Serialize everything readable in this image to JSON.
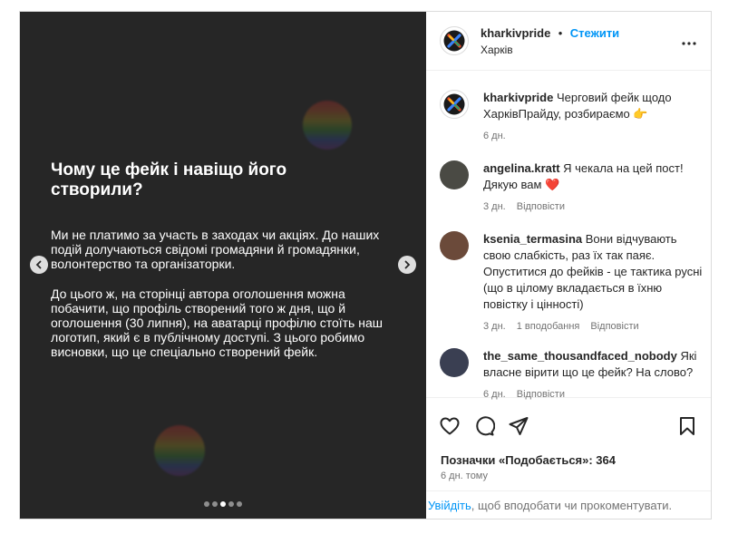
{
  "slide": {
    "title": "Чому це фейк і навіщо його створили?",
    "paragraph1": "Ми не платимо за участь в заходах чи акціях. До наших подій долучаються свідомі громадяни й громадянки, волонтерство та організаторки.",
    "paragraph2": "До цього ж, на сторінці автора оголошення можна побачити, що профіль створений того ж дня, що й оголошення (30 липня), на аватарці профілю стоїть наш логотип, який є в публічному доступі. З цього робимо висновки, що це спеціально створений фейк.",
    "dots_count": 5,
    "active_dot": 2
  },
  "header": {
    "username": "kharkivpride",
    "separator": "•",
    "follow_label": "Стежити",
    "location": "Харків",
    "more_icon": "more-horizontal-icon"
  },
  "caption": {
    "username": "kharkivpride",
    "text": "Черговий фейк щодо ХарківПрайду, розбираємо 👉",
    "time": "6 дн."
  },
  "comments": [
    {
      "username": "angelina.kratt",
      "text": "Я чекала на цей пост! Дякую вам ❤️",
      "time": "3 дн.",
      "likes": "",
      "reply": "Відповісти",
      "avatar_color": "#4a4a44"
    },
    {
      "username": "ksenia_termasina",
      "text": "Вони відчувають свою слабкість, раз їх так паяє. Опуститися до фейків - це тактика русні (що в цілому вкладається в їхню повістку і цінності)",
      "time": "3 дн.",
      "likes": "1 вподобання",
      "reply": "Відповісти",
      "avatar_color": "#6b4a3a"
    },
    {
      "username": "the_same_thousandfaced_nobody",
      "text": "Які власне вірити що це фейк? На слово?",
      "time": "6 дн.",
      "likes": "",
      "reply": "Відповісти",
      "avatar_color": "#3a3f52"
    }
  ],
  "footer": {
    "likes_label": "Позначки «Подобається»: 364",
    "time": "6 дн. тому",
    "login_link": "Увійдіть",
    "login_text": ", щоб вподобати чи прокоментувати."
  },
  "colors": {
    "accent": "#0095f6",
    "heart": "#ed4956",
    "slide_bg": "#262626"
  }
}
